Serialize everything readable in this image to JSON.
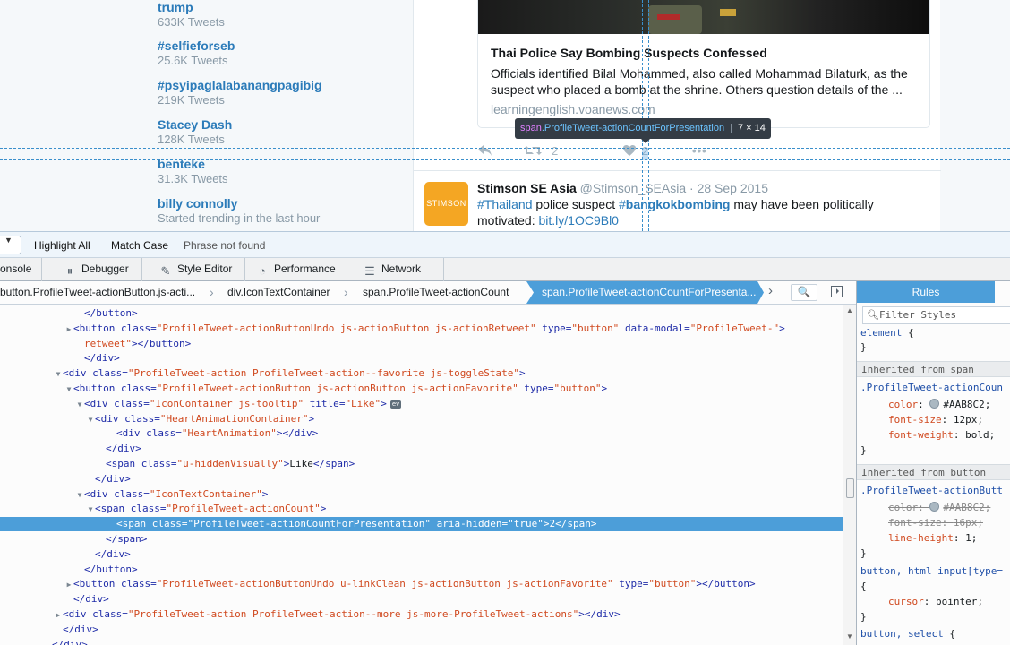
{
  "trends": [
    {
      "name": "trump",
      "meta": "633K Tweets"
    },
    {
      "name": "#selfieforseb",
      "meta": "25.6K Tweets"
    },
    {
      "name": "#psyipaglalabanangpagibig",
      "meta": "219K Tweets"
    },
    {
      "name": "Stacey Dash",
      "meta": "128K Tweets"
    },
    {
      "name": "benteke",
      "meta": "31.3K Tweets"
    },
    {
      "name": "billy connolly",
      "meta": "Started trending in the last hour"
    }
  ],
  "card": {
    "title": "Thai Police Say Bombing Suspects Confessed",
    "description": "Officials identified Bilal Mohammed, also called Mohammad Bilaturk, as the suspect who placed a bomb at the shrine. Others question details of the ...",
    "domain": "learningenglish.voanews.com"
  },
  "tweet_actions": {
    "retweet_count": "2",
    "like_count": "2"
  },
  "inspector_tooltip": {
    "tag": "span",
    "class": ".ProfileTweet-actionCountForPresentation",
    "size": "7 × 14"
  },
  "tweet": {
    "avatar_text": "STIMSON",
    "name": "Stimson SE Asia",
    "handle": "@Stimson_SEAsia",
    "date": "· 28 Sep 2015",
    "hashtag1": "#Thailand",
    "text_mid": " police suspect ",
    "hashtag2_hash": "#",
    "hashtag2_word": "bangkokbombing",
    "text_end": " may have been politically motivated: ",
    "link": "bit.ly/1OC9Bl0"
  },
  "findbar": {
    "highlight_all": "Highlight All",
    "match_case": "Match Case",
    "status": "Phrase not found"
  },
  "toolbar": {
    "console": "onsole",
    "debugger": "Debugger",
    "style_editor": "Style Editor",
    "performance": "Performance",
    "network": "Network"
  },
  "breadcrumbs": [
    "button.ProfileTweet-actionButton.js-acti...",
    "div.IconTextContainer",
    "span.ProfileTweet-actionCount",
    "span.ProfileTweet-actionCountForPresenta..."
  ],
  "markup_lines": [
    {
      "indent": 8,
      "twisty": "",
      "html": "&lt;/button&gt;",
      "raw": true
    },
    {
      "indent": 7,
      "twisty": "▶",
      "raw": false,
      "tag": "button",
      "attrs": [
        [
          "class",
          "ProfileTweet-actionButtonUndo js-actionButton js-actionRetweet"
        ],
        [
          "type",
          "button"
        ],
        [
          "data-modal",
          "ProfileTweet-"
        ]
      ]
    },
    {
      "indent": 8,
      "twisty": "",
      "raw": false,
      "cont": "retweet",
      "close": "button"
    },
    {
      "indent": 8,
      "twisty": "",
      "raw": true,
      "html": "&lt;/div&gt;"
    },
    {
      "indent": 6,
      "twisty": "▼",
      "raw": false,
      "tag": "div",
      "attrs": [
        [
          "class",
          "ProfileTweet-action ProfileTweet-action--favorite js-toggleState"
        ]
      ]
    },
    {
      "indent": 7,
      "twisty": "▼",
      "raw": false,
      "tag": "button",
      "attrs": [
        [
          "class",
          "ProfileTweet-actionButton js-actionButton js-actionFavorite"
        ],
        [
          "type",
          "button"
        ]
      ]
    },
    {
      "indent": 8,
      "twisty": "▼",
      "raw": false,
      "tag": "div",
      "attrs": [
        [
          "class",
          "IconContainer js-tooltip"
        ],
        [
          "title",
          "Like"
        ]
      ],
      "ev": "ev"
    },
    {
      "indent": 9,
      "twisty": "▼",
      "raw": false,
      "tag": "div",
      "attrs": [
        [
          "class",
          "HeartAnimationContainer"
        ]
      ]
    },
    {
      "indent": 11,
      "twisty": "",
      "raw": false,
      "tag": "div",
      "attrs": [
        [
          "class",
          "HeartAnimation"
        ]
      ],
      "inline_close": "div"
    },
    {
      "indent": 10,
      "twisty": "",
      "raw": true,
      "html": "&lt;/div&gt;"
    },
    {
      "indent": 10,
      "twisty": "",
      "raw": false,
      "tag": "span",
      "attrs": [
        [
          "class",
          "u-hiddenVisually"
        ]
      ],
      "text": "Like",
      "inline_close": "span"
    },
    {
      "indent": 9,
      "twisty": "",
      "raw": true,
      "html": "&lt;/div&gt;"
    },
    {
      "indent": 8,
      "twisty": "▼",
      "raw": false,
      "tag": "div",
      "attrs": [
        [
          "class",
          "IconTextContainer"
        ]
      ]
    },
    {
      "indent": 9,
      "twisty": "▼",
      "raw": false,
      "tag": "span",
      "attrs": [
        [
          "class",
          "ProfileTweet-actionCount"
        ]
      ]
    },
    {
      "indent": 11,
      "twisty": "",
      "raw": false,
      "selected": true,
      "tag": "span",
      "attrs": [
        [
          "class",
          "ProfileTweet-actionCountForPresentation"
        ],
        [
          "aria-hidden",
          "true"
        ]
      ],
      "text": "2",
      "inline_close": "span"
    },
    {
      "indent": 10,
      "twisty": "",
      "raw": true,
      "html": "&lt;/span&gt;"
    },
    {
      "indent": 9,
      "twisty": "",
      "raw": true,
      "html": "&lt;/div&gt;"
    },
    {
      "indent": 8,
      "twisty": "",
      "raw": true,
      "html": "&lt;/button&gt;"
    },
    {
      "indent": 7,
      "twisty": "▶",
      "raw": false,
      "tag": "button",
      "attrs": [
        [
          "class",
          "ProfileTweet-actionButtonUndo u-linkClean js-actionButton js-actionFavorite"
        ],
        [
          "type",
          "button"
        ]
      ],
      "inline_close": "button"
    },
    {
      "indent": 7,
      "twisty": "",
      "raw": true,
      "html": "&lt;/div&gt;"
    },
    {
      "indent": 6,
      "twisty": "▶",
      "raw": false,
      "tag": "div",
      "attrs": [
        [
          "class",
          "ProfileTweet-action ProfileTweet-action--more js-more-ProfileTweet-actions"
        ]
      ],
      "inline_close": "div"
    },
    {
      "indent": 6,
      "twisty": "",
      "raw": true,
      "html": "&lt;/div&gt;"
    },
    {
      "indent": 5,
      "twisty": "",
      "raw": true,
      "html": "&lt;/div&gt;"
    }
  ],
  "rules_panel": {
    "tab": "Rules",
    "filter_placeholder": "Filter Styles",
    "element_rule": "element",
    "inherited_span": "Inherited from span",
    "span_selector": ".ProfileTweet-actionCoun",
    "span_props": [
      {
        "name": "color",
        "value": "#AAB8C2;",
        "swatch": true
      },
      {
        "name": "font-size",
        "value": "12px;"
      },
      {
        "name": "font-weight",
        "value": "bold;"
      }
    ],
    "inherited_button": "Inherited from button",
    "button_selector": ".ProfileTweet-actionButt",
    "button_props": [
      {
        "name": "color",
        "value": "#AAB8C2;",
        "swatch": true,
        "struck": true
      },
      {
        "name": "font-size",
        "value": "16px;",
        "struck": true
      },
      {
        "name": "line-height",
        "value": "1;"
      }
    ],
    "rule3_selector": "button, html input[type=",
    "rule3_props": [
      {
        "name": "cursor",
        "value": "pointer;"
      }
    ],
    "rule4_selector": "button, select"
  },
  "colors": {
    "link": "#2b7bb9",
    "selection": "#4c9ed9",
    "swatch": "#AAB8C2"
  }
}
